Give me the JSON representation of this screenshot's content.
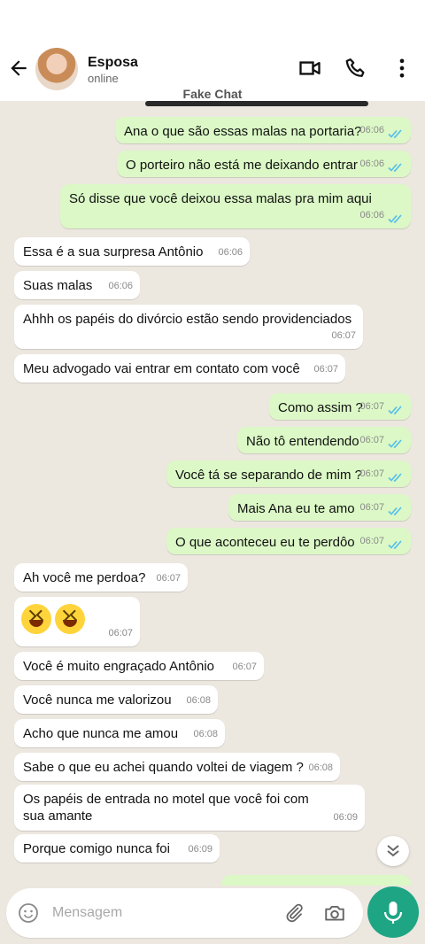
{
  "header": {
    "contact_name": "Esposa",
    "status": "online",
    "icons": [
      "back-arrow-icon",
      "video-call-icon",
      "phone-icon",
      "more-options-icon"
    ]
  },
  "watermark": "Fake Chat",
  "messages": [
    {
      "dir": "out",
      "text": "Ana o que são essas malas na portaria?",
      "time": "06:06",
      "ticks": "read"
    },
    {
      "dir": "out",
      "text": "O porteiro não está me deixando entrar",
      "time": "06:06",
      "ticks": "read"
    },
    {
      "dir": "out",
      "text": "Só disse que você deixou essa malas pra mim aqui",
      "time": "06:06",
      "ticks": "read"
    },
    {
      "dir": "in",
      "text": "Essa é a sua surpresa Antônio",
      "time": "06:06"
    },
    {
      "dir": "in",
      "text": "Suas malas",
      "time": "06:06"
    },
    {
      "dir": "in",
      "text": "Ahhh os papéis do divórcio estão sendo providenciados",
      "time": "06:07"
    },
    {
      "dir": "in",
      "text": "Meu advogado vai entrar em contato com você",
      "time": "06:07"
    },
    {
      "dir": "out",
      "text": "Como assim ?",
      "time": "06:07",
      "ticks": "read"
    },
    {
      "dir": "out",
      "text": "Não tô entendendo",
      "time": "06:07",
      "ticks": "read"
    },
    {
      "dir": "out",
      "text": "Você tá se separando de mim ?",
      "time": "06:07",
      "ticks": "read"
    },
    {
      "dir": "out",
      "text": "Mais Ana eu te amo",
      "time": "06:07",
      "ticks": "read"
    },
    {
      "dir": "out",
      "text": "O que aconteceu eu te perdôo",
      "time": "06:07",
      "ticks": "read"
    },
    {
      "dir": "in",
      "text": "Ah você me perdoa?",
      "time": "06:07"
    },
    {
      "dir": "in",
      "text": "",
      "emoji": "laughing-emoji x2",
      "time": "06:07"
    },
    {
      "dir": "in",
      "text": "Você é muito engraçado Antônio",
      "time": "06:07"
    },
    {
      "dir": "in",
      "text": "Você nunca me valorizou",
      "time": "06:08"
    },
    {
      "dir": "in",
      "text": "Acho que nunca me amou",
      "time": "06:08"
    },
    {
      "dir": "in",
      "text": "Sabe o que eu achei quando voltei de viagem ?",
      "time": "06:08"
    },
    {
      "dir": "in",
      "text": "Os papéis de entrada no motel que você foi com sua amante",
      "time": "06:09"
    },
    {
      "dir": "in",
      "text": "Porque comigo nunca foi",
      "time": "06:09"
    }
  ],
  "composer": {
    "placeholder": "Mensagem",
    "icons": [
      "emoji-icon",
      "attach-icon",
      "camera-icon",
      "mic-icon"
    ]
  },
  "colors": {
    "outgoing_bubble": "#dbf8c6",
    "incoming_bubble": "#ffffff",
    "chat_bg": "#ece7df",
    "accent": "#1ea584",
    "read_ticks": "#53bdeb"
  }
}
